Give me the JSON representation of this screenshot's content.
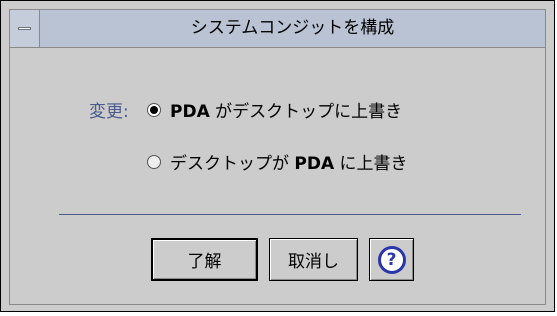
{
  "window": {
    "title": "システムコンジットを構成"
  },
  "form": {
    "prompt": "変更:",
    "options": [
      {
        "prefix": "",
        "bold": "PDA",
        "suffix": " がデスクトップに上書き",
        "checked": true
      },
      {
        "prefix": "デスクトップが ",
        "bold": "PDA",
        "suffix": " に上書き",
        "checked": false
      }
    ]
  },
  "buttons": {
    "ok": "了解",
    "cancel": "取消し",
    "help": "?"
  },
  "colors": {
    "titlebar": "#b9c3d4",
    "window_bg": "#cccccc",
    "accent_label": "#4a5b8c",
    "help_icon": "#2a35a8"
  }
}
